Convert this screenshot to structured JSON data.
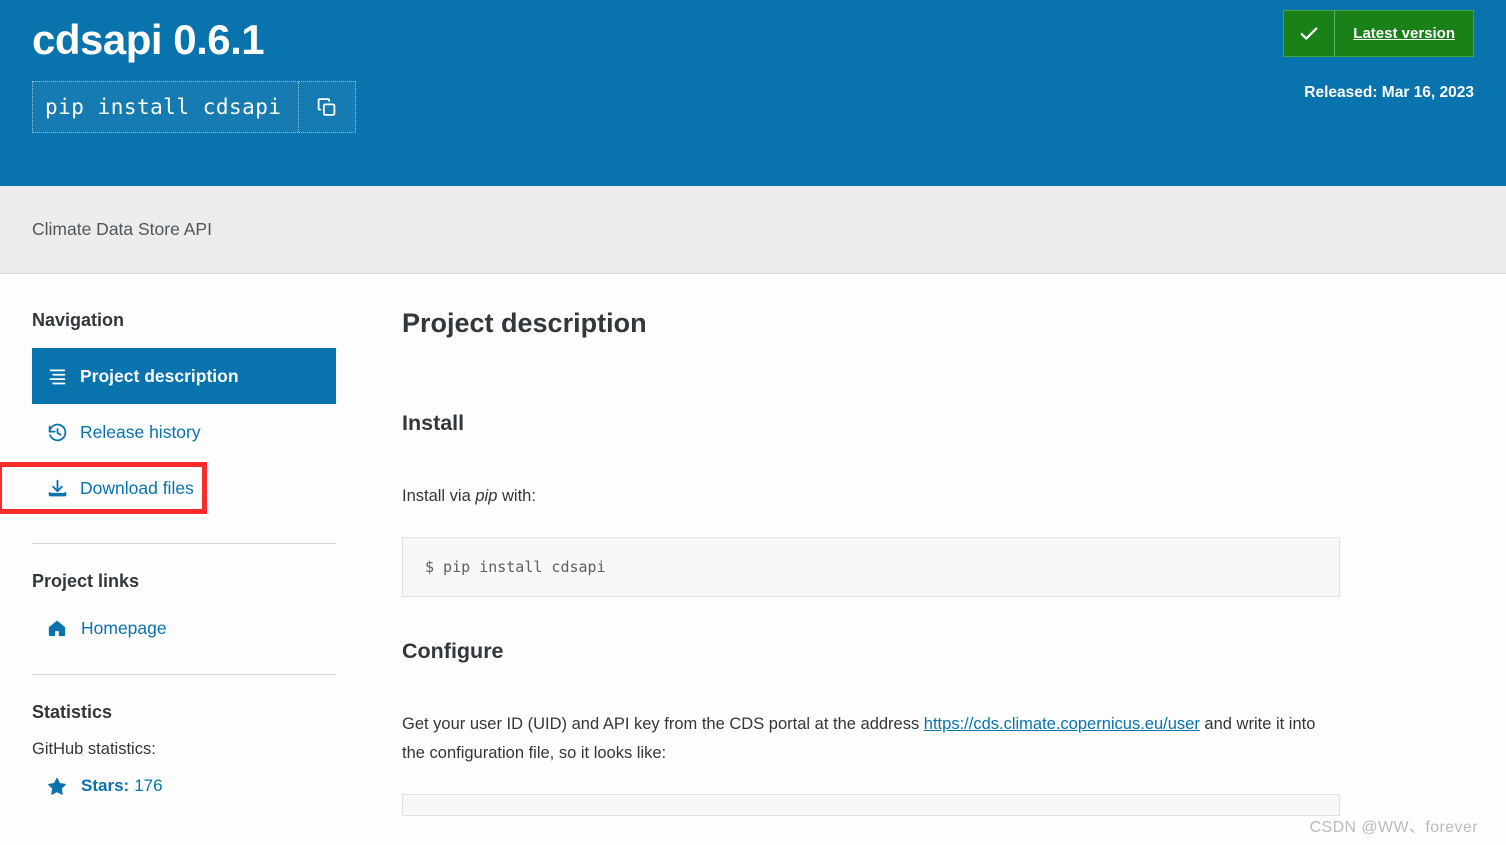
{
  "banner": {
    "title": "cdsapi 0.6.1",
    "install_command": "pip install cdsapi",
    "copy_icon": "copy-icon",
    "check_icon": "check-icon",
    "version_badge_label": "Latest version",
    "released_text": "Released: Mar 16, 2023",
    "bg_color": "#0873ad",
    "badge_color": "#1a8118"
  },
  "subtitle": {
    "text": "Climate Data Store API"
  },
  "sidebar": {
    "nav_heading": "Navigation",
    "nav_items": [
      {
        "label": "Project description",
        "icon": "list-lines-icon",
        "active": true
      },
      {
        "label": "Release history",
        "icon": "history-clock-icon",
        "active": false
      },
      {
        "label": "Download files",
        "icon": "download-icon",
        "active": false
      }
    ],
    "highlight_color": "#fa2b2b",
    "links_heading": "Project links",
    "links": [
      {
        "label": "Homepage",
        "icon": "home-icon"
      }
    ],
    "stats_heading": "Statistics",
    "stats_note": "GitHub statistics:",
    "stats": [
      {
        "icon": "star-icon",
        "label": "Stars:",
        "value": "176"
      }
    ]
  },
  "main": {
    "page_title": "Project description",
    "install_heading": "Install",
    "install_paragraph_pre": "Install via ",
    "install_paragraph_em": "pip",
    "install_paragraph_post": " with:",
    "install_code": "$ pip install cdsapi",
    "configure_heading": "Configure",
    "configure_paragraph_pre": "Get your user ID (UID) and API key from the CDS portal at the address ",
    "configure_link": "https://cds.climate.copernicus.eu/user",
    "configure_paragraph_post": " and write it into the configuration file, so it looks like:"
  },
  "watermark": {
    "text": "CSDN @WW、forever"
  }
}
